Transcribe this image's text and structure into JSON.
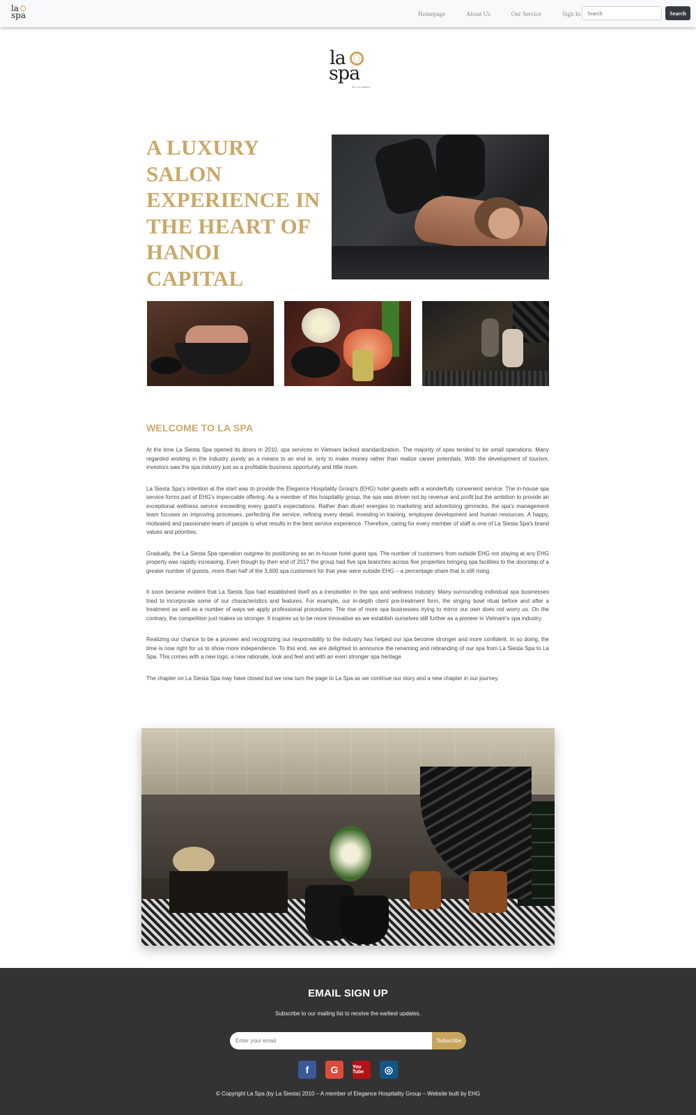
{
  "nav": {
    "logo_text_top": "la",
    "logo_text_bottom": "spa",
    "links": [
      "Homepage",
      "About Us",
      "Our Service",
      "Sign In"
    ],
    "search_placeholder": "Search",
    "search_button": "Search"
  },
  "logo": {
    "text_top": "la",
    "text_bottom": "spa",
    "tagline": "BY LA SIESTA"
  },
  "hero": {
    "title": "A LUXURY SALON EXPERIENCE IN THE HEART OF HANOI CAPITAL"
  },
  "welcome": {
    "title": "WELCOME TO LA SPA",
    "paragraphs": [
      "At the time La Siesta Spa opened its doors in 2010, spa services in Vietnam lacked standardization. The majority of spas tended to be small operations. Many regarded working in the industry purely as a means to an end ie. only to make money rather than realize career potentials. With the development of tourism, investors saw the spa industry just as a profitable business opportunity and little more.",
      "La Siesta Spa's intention at the start was to provide the Elegance Hospitality Group's (EHG) hotel guests with a wonderfully convenient service. The in-house spa service forms part of EHG's impeccable offering. As a member of this hospitality group, the spa was driven not by revenue and profit but the ambition to provide an exceptional wellness service exceeding every guest's expectations. Rather than divert energies to marketing and advertising gimmicks, the spa's management team focuses on improving processes, perfecting the service, refining every detail, investing in training, employee development and human resources. A happy, motivated and passionate team of people is what results in the best service experience. Therefore, caring for every member of staff is one of La Siesta Spa's brand values and priorities.",
      "Gradually, the La Siesta Spa operation outgrew its positioning as an in-house hotel guest spa. The number of customers from outside EHG not staying at any EHG property was rapidly increasing. Even though by then end of 2017 the group had five spa branches across five properties bringing spa facilities to the doorstep of a greater number of guests, more than half of the 3,600 spa customers for that year were outside EHG – a percentage share that is still rising.",
      "It soon became evident that La Siesta Spa had established itself as a trendsetter in the spa and wellness industry. Many surrounding individual spa businesses tried to incorporate some of our characteristics and features. For example, our in-depth client pre-treatment form, the singing bowl ritual before and after a treatment as well as a number of ways we apply professional procedures. The rise of more spa businesses trying to mirror our own does not worry us. On the contrary, the competition just makes us stronger. It inspires us to be more innovative as we establish ourselves still further as a pioneer in Vietnam's spa industry.",
      "Realizing our chance to be a pioneer and recognizing our responsibility to the industry has helped our spa become stronger and more confident. In so doing, the time is now right for us to show more independence. To this end, we are delighted to announce the renaming and rebranding of our spa from La Siesta Spa to La Spa. This comes with a new logo, a new rationale, look and feel and with an even stronger spa heritage.",
      "The chapter on La Siesta Spa may have closed but we now turn the page to La Spa as we continue our story and a new chapter in our journey."
    ]
  },
  "footer": {
    "title": "EMAIL SIGN UP",
    "subtitle": "Subscribe to our mailing list to receive the earliest updates.",
    "email_placeholder": "Enter your email",
    "subscribe_button": "Subscribe",
    "socials": [
      {
        "icon": "facebook-icon",
        "glyph": "f"
      },
      {
        "icon": "google-icon",
        "glyph": "G"
      },
      {
        "icon": "youtube-icon",
        "glyph": "You Tube"
      },
      {
        "icon": "instagram-icon",
        "glyph": "◎"
      }
    ],
    "copyright": "© Copyright La Spa (by La Siesta) 2010 – A member of Elegance Hospitality Group – Website built by EHG"
  },
  "colors": {
    "gold": "#c9a86a",
    "accent": "#c9a45c",
    "footer_bg": "#333333",
    "nav_bg": "#f8f9fa"
  }
}
